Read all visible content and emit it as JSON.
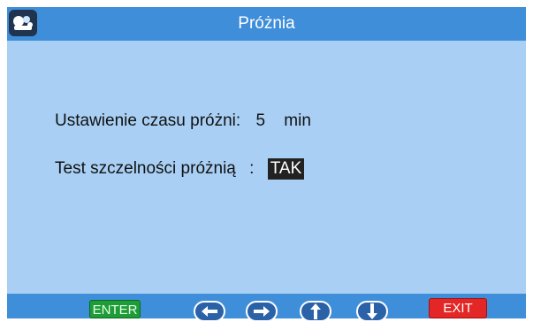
{
  "header": {
    "title": "Próżnia",
    "icon": "app-logo-icon"
  },
  "settings": {
    "vacuum_time": {
      "label": "Ustawienie czasu próżni:",
      "value": "5",
      "unit": "min"
    },
    "leak_test": {
      "label": "Test szczelności próżnią",
      "separator": ":",
      "value": "TAK"
    }
  },
  "footer": {
    "enter_label": "ENTER",
    "exit_label": "EXIT",
    "nav_icons": [
      "arrow-left-icon",
      "arrow-right-icon",
      "arrow-up-icon",
      "arrow-down-icon"
    ]
  },
  "colors": {
    "background": "#a9d0f4",
    "bar": "#3f8ed9",
    "enter": "#1e9c38",
    "exit": "#e32626",
    "highlight": "#222222"
  }
}
